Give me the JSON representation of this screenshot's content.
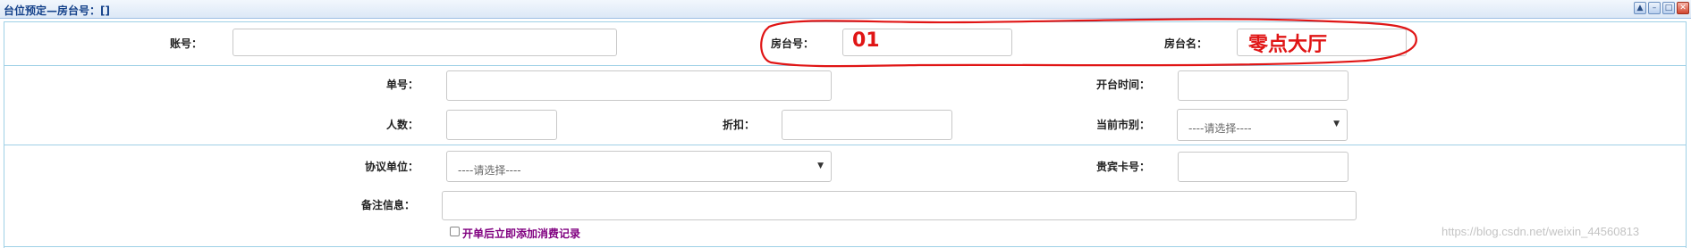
{
  "window": {
    "title": "台位预定—房台号：[]",
    "buttons": {
      "collapse_icon": "chevron-up",
      "minimize_icon": "minimize",
      "maximize_icon": "maximize",
      "close_icon": "close"
    }
  },
  "form": {
    "account": {
      "label": "账号：",
      "value": ""
    },
    "room_no": {
      "label": "房台号：",
      "value": "01"
    },
    "room_name": {
      "label": "房台名：",
      "value": "零点大厅"
    },
    "order_no": {
      "label": "单号：",
      "value": ""
    },
    "open_time": {
      "label": "开台时间：",
      "value": ""
    },
    "people": {
      "label": "人数：",
      "value": ""
    },
    "discount": {
      "label": "折扣：",
      "value": ""
    },
    "currency": {
      "label": "当前市别：",
      "selected": "----请选择----"
    },
    "agreement_unit": {
      "label": "协议单位：",
      "selected": "----请选择----"
    },
    "vip_card": {
      "label": "贵宾卡号：",
      "value": ""
    },
    "remarks": {
      "label": "备注信息：",
      "value": ""
    },
    "add_consumption": {
      "label": "开单后立即添加消费记录",
      "checked": false
    }
  },
  "annotation": {
    "color": "#e01515"
  },
  "watermark": "https://blog.csdn.net/weixin_44560813"
}
